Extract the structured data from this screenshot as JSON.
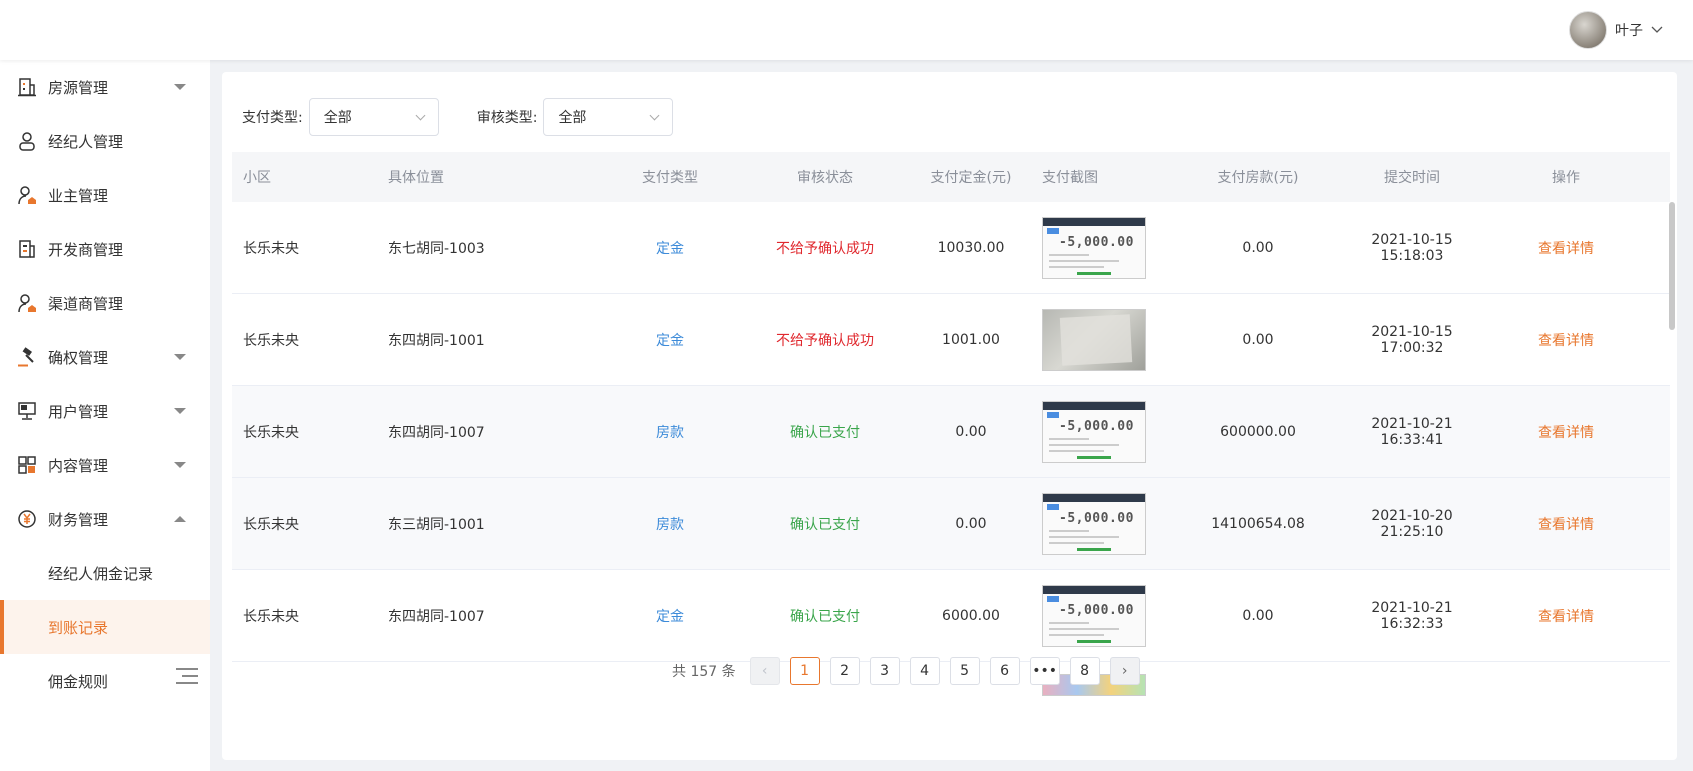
{
  "header": {
    "username": "叶子"
  },
  "sidebar": {
    "items": [
      {
        "label": "房源管理"
      },
      {
        "label": "经纪人管理"
      },
      {
        "label": "业主管理"
      },
      {
        "label": "开发商管理"
      },
      {
        "label": "渠道商管理"
      },
      {
        "label": "确权管理"
      },
      {
        "label": "用户管理"
      },
      {
        "label": "内容管理"
      },
      {
        "label": "财务管理"
      }
    ],
    "sub_items": [
      {
        "label": "经纪人佣金记录"
      },
      {
        "label": "到账记录"
      },
      {
        "label": "佣金规则"
      }
    ]
  },
  "filters": {
    "pay_type_label": "支付类型:",
    "pay_type_value": "全部",
    "review_type_label": "审核类型:",
    "review_type_value": "全部"
  },
  "table": {
    "headers": [
      "小区",
      "具体位置",
      "支付类型",
      "审核状态",
      "支付定金(元)",
      "支付截图",
      "支付房款(元)",
      "提交时间",
      "操作"
    ],
    "rows": [
      {
        "community": "长乐未央",
        "location": "东七胡同-1003",
        "pay_type": "定金",
        "status": "不给予确认成功",
        "deposit": "10030.00",
        "payment": "0.00",
        "time": "2021-10-15 15:18:03",
        "action": "查看详情"
      },
      {
        "community": "长乐未央",
        "location": "东四胡同-1001",
        "pay_type": "定金",
        "status": "不给予确认成功",
        "deposit": "1001.00",
        "payment": "0.00",
        "time": "2021-10-15 17:00:32",
        "action": "查看详情"
      },
      {
        "community": "长乐未央",
        "location": "东四胡同-1007",
        "pay_type": "房款",
        "status": "确认已支付",
        "deposit": "0.00",
        "payment": "600000.00",
        "time": "2021-10-21 16:33:41",
        "action": "查看详情"
      },
      {
        "community": "长乐未央",
        "location": "东三胡同-1001",
        "pay_type": "房款",
        "status": "确认已支付",
        "deposit": "0.00",
        "payment": "14100654.08",
        "time": "2021-10-20 21:25:10",
        "action": "查看详情"
      },
      {
        "community": "长乐未央",
        "location": "东四胡同-1007",
        "pay_type": "定金",
        "status": "确认已支付",
        "deposit": "6000.00",
        "payment": "0.00",
        "time": "2021-10-21 16:32:33",
        "action": "查看详情"
      }
    ],
    "thumb_text": "-5,000.00"
  },
  "pagination": {
    "total": "共 157 条",
    "pages": [
      "1",
      "2",
      "3",
      "4",
      "5",
      "6",
      "•••",
      "8"
    ],
    "prev": "‹",
    "next": "›"
  },
  "colors": {
    "accent": "#e8772e",
    "link_blue": "#3d8bd9",
    "status_red": "#e0282e",
    "status_green": "#3aa54b"
  }
}
